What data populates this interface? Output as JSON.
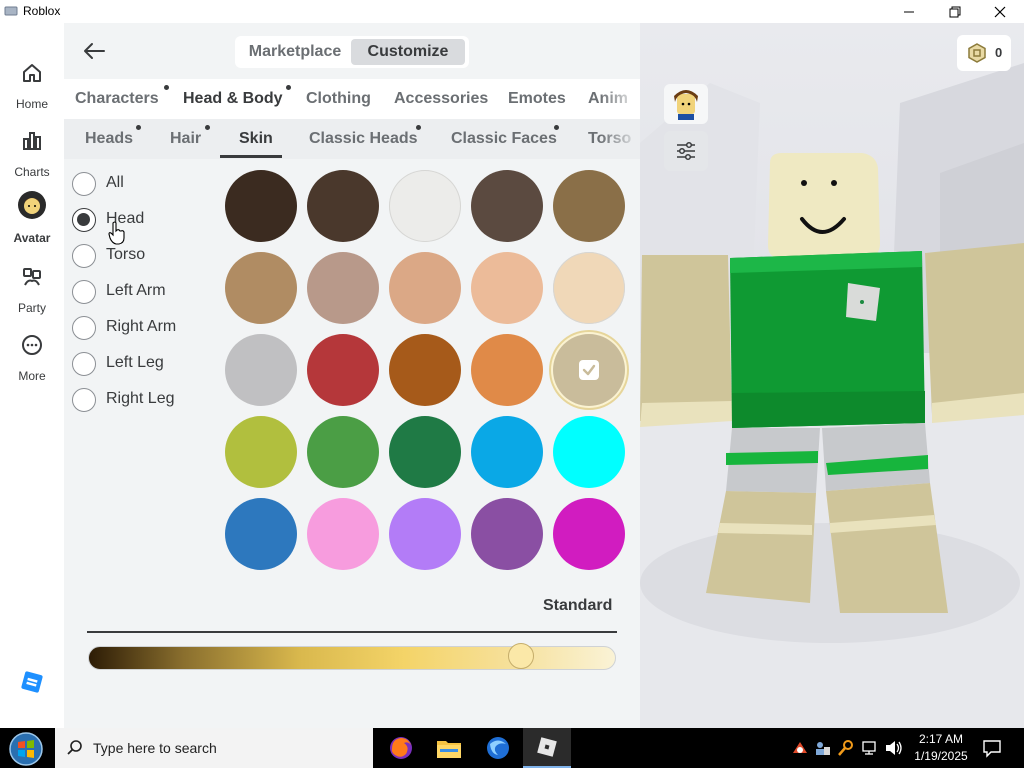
{
  "window": {
    "title": "Roblox"
  },
  "sidebar": {
    "items": [
      {
        "label": "Home",
        "icon": "home-icon"
      },
      {
        "label": "Charts",
        "icon": "charts-icon"
      },
      {
        "label": "Avatar",
        "icon": "avatar-icon",
        "active": true
      },
      {
        "label": "Party",
        "icon": "party-icon"
      },
      {
        "label": "More",
        "icon": "more-icon"
      }
    ]
  },
  "topbar": {
    "segments": [
      "Marketplace",
      "Customize"
    ],
    "selected_segment": "Customize"
  },
  "category_tabs": [
    {
      "label": "Characters",
      "dot": true
    },
    {
      "label": "Head & Body",
      "dot": true,
      "active": true
    },
    {
      "label": "Clothing"
    },
    {
      "label": "Accessories"
    },
    {
      "label": "Emotes"
    },
    {
      "label": "Anim"
    }
  ],
  "sub_tabs": [
    {
      "label": "Heads",
      "dot": true
    },
    {
      "label": "Hair",
      "dot": true
    },
    {
      "label": "Skin",
      "active": true
    },
    {
      "label": "Classic Heads",
      "dot": true
    },
    {
      "label": "Classic Faces",
      "dot": true
    },
    {
      "label": "Torso"
    }
  ],
  "body_parts": {
    "options": [
      "All",
      "Head",
      "Torso",
      "Left Arm",
      "Right Arm",
      "Left Leg",
      "Right Leg"
    ],
    "selected": "Head"
  },
  "skin_colors": [
    "#3b2b20",
    "#4a382c",
    "#ececea",
    "#5b4a40",
    "#8a6f48",
    "#b08c63",
    "#b8998a",
    "#dba886",
    "#ecbb99",
    "#f0d8b8",
    "#c0c0c2",
    "#b5373a",
    "#a65a1a",
    "#e08a48",
    "#c9bc9b",
    "#b1bf3e",
    "#4b9e45",
    "#1f7a45",
    "#0aa8e6",
    "#00ffff",
    "#2d78be",
    "#f79cde",
    "#b37cf7",
    "#8a4fa3",
    "#d11cc0"
  ],
  "selected_skin_index": 14,
  "tone": {
    "label": "Standard",
    "value_fraction": 0.82
  },
  "robux": {
    "balance": "0"
  },
  "taskbar": {
    "search_placeholder": "Type here to search",
    "time": "2:17 AM",
    "date": "1/19/2025"
  },
  "colors": {
    "accent": "#393b3d",
    "panel_bg": "#f2f4f5"
  }
}
